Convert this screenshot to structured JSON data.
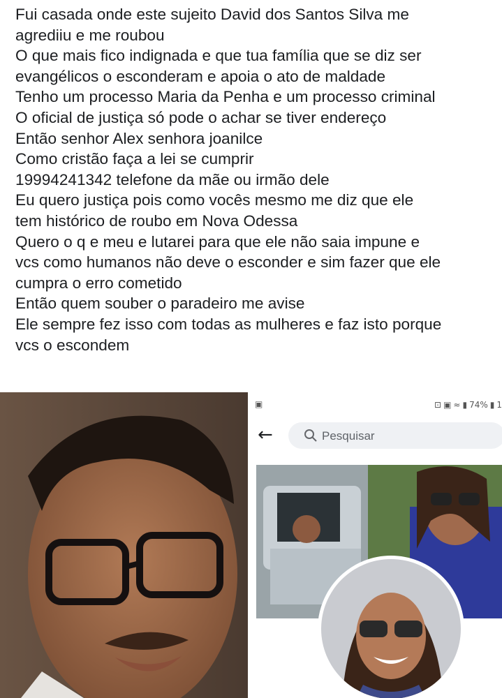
{
  "post": {
    "lines": [
      "Fui casada onde este sujeito David dos Santos Silva me",
      "agrediiu e me roubou",
      "O que mais fico indignada e que tua família que se diz ser",
      "evangélicos o esconderam e apoia o ato de maldade",
      "Tenho um processo Maria da Penha e um processo criminal",
      "O oficial de justiça só pode o achar se tiver endereço",
      "Então senhor Alex senhora joanilce",
      "Como cristão faça a lei se cumprir",
      "19994241342 telefone da mãe ou irmão dele",
      "Eu quero justiça pois como vocês mesmo me diz que ele",
      "tem histórico de roubo em Nova Odessa",
      "Quero o q e meu e lutarei para que ele não saia impune e",
      "vcs como humanos não deve o esconder e sim fazer que ele",
      "cumpra o erro cometido",
      "Então quem souber o paradeiro me avise",
      "Ele sempre fez isso com todas as mulheres e faz isto porque",
      "vcs o escondem"
    ]
  },
  "screenshot": {
    "status": {
      "left_icon": "notification-icon",
      "battery": "74%",
      "time_fragment": "1",
      "icons": [
        "lock-icon",
        "image-icon",
        "wifi-icon",
        "signal-icon",
        "battery-icon"
      ]
    },
    "search": {
      "placeholder": "Pesquisar",
      "back_icon": "back-arrow-icon",
      "search_icon": "search-icon"
    }
  }
}
